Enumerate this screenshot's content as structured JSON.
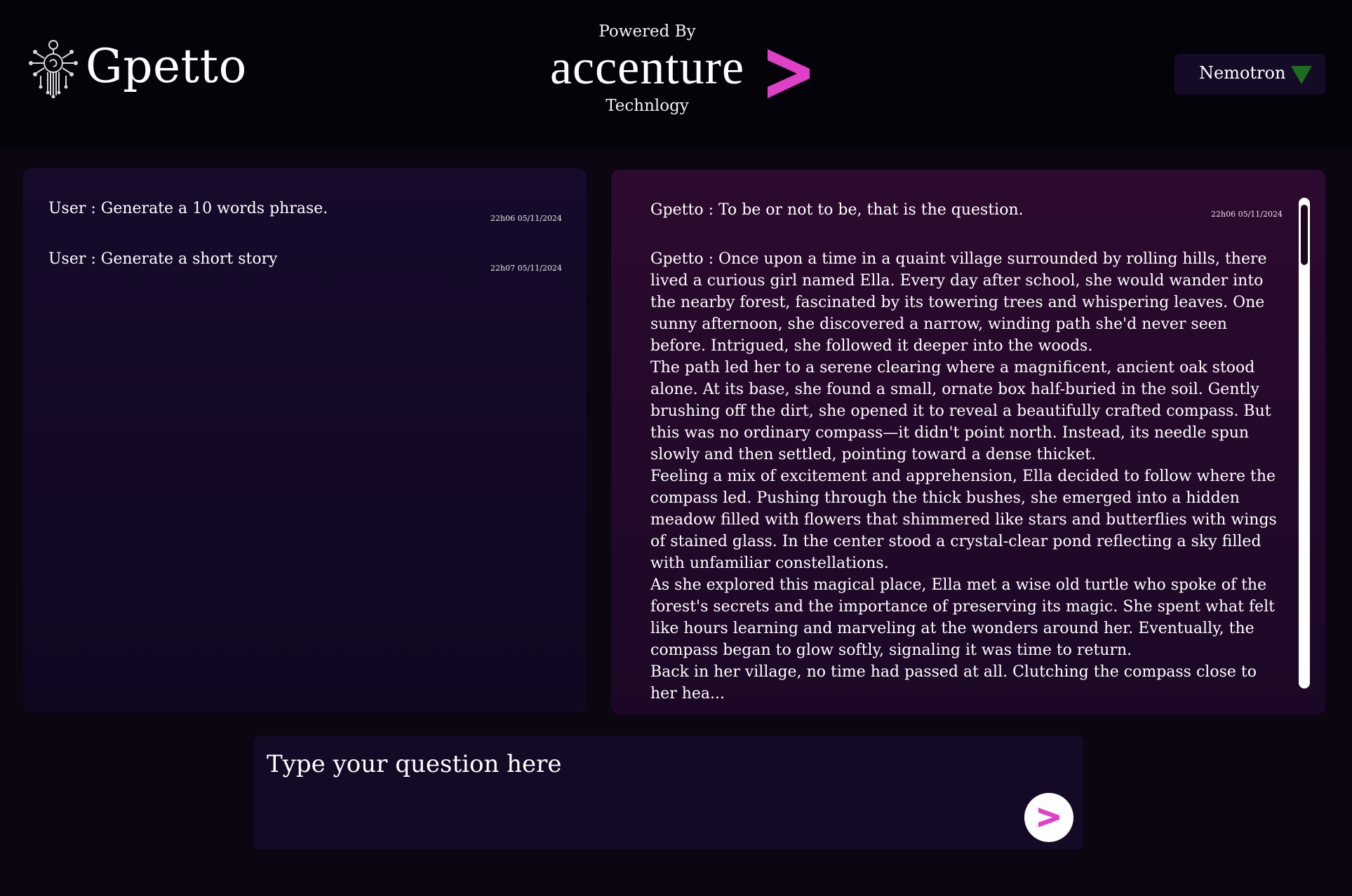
{
  "header": {
    "app_title": "Gpetto",
    "logo_icon": "gpetto-circuit-logo",
    "powered_by": "Powered By",
    "brand": "accenture",
    "tagline": "Technlogy",
    "brand_chevron_color": "#e040c8"
  },
  "model_select": {
    "selected": "Nemotron",
    "caret_color": "#1f6b1f"
  },
  "user_history": [
    {
      "text": "User : Generate a 10 words phrase.",
      "time": "22h06 05/11/2024"
    },
    {
      "text": "User : Generate a short story",
      "time": "22h07 05/11/2024"
    }
  ],
  "responses": {
    "first": {
      "text": "Gpetto : To be or not to be, that is the question.",
      "time": "22h06 05/11/2024"
    },
    "story": "Gpetto : Once upon a time in a quaint village surrounded by rolling hills, there lived a curious girl named Ella. Every day after school, she would wander into the nearby forest, fascinated by its towering trees and whispering leaves. One sunny afternoon, she discovered a narrow, winding path she'd never seen before. Intrigued, she followed it deeper into the woods.\nThe path led her to a serene clearing where a magnificent, ancient oak stood alone. At its base, she found a small, ornate box half-buried in the soil. Gently brushing off the dirt, she opened it to reveal a beautifully crafted compass. But this was no ordinary compass—it didn't point north. Instead, its needle spun slowly and then settled, pointing toward a dense thicket.\nFeeling a mix of excitement and apprehension, Ella decided to follow where the compass led. Pushing through the thick bushes, she emerged into a hidden meadow filled with flowers that shimmered like stars and butterflies with wings of stained glass. In the center stood a crystal-clear pond reflecting a sky filled with unfamiliar constellations.\nAs she explored this magical place, Ella met a wise old turtle who spoke of the forest's secrets and the importance of preserving its magic. She spent what felt like hours learning and marveling at the wonders around her. Eventually, the compass began to glow softly, signaling it was time to return.\nBack in her village, no time had passed at all. Clutching the compass close to her hea..."
  },
  "input": {
    "placeholder": "Type your question here",
    "value": ""
  },
  "send": {
    "icon": "send-chevron-icon",
    "color": "#e040c8"
  }
}
